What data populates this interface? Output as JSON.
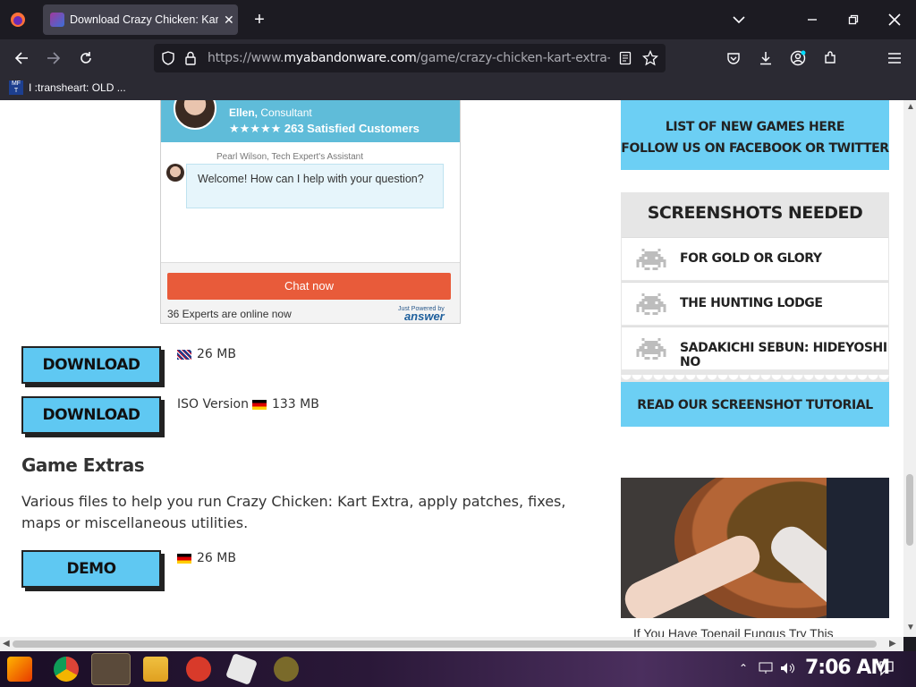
{
  "browser": {
    "tab_title": "Download Crazy Chicken: Kart Extra",
    "tab_close": "✕",
    "new_tab": "+",
    "url_prefix": "https://www.",
    "url_domain": "myabandonware.com",
    "url_path": "/game/crazy-chicken-kart-extra-do",
    "bookmark_label": "I :transheart: OLD ...",
    "bookmark_icon_text": "MF T"
  },
  "chat_widget": {
    "expert_name": "Ellen,",
    "expert_title": "Consultant",
    "rating": "★★★★★ 263 Satisfied Customers",
    "assistant_label": "Pearl Wilson, Tech Expert's Assistant",
    "message": "Welcome! How can I help with your question?",
    "chat_button": "Chat now",
    "online_text": "36 Experts are online now",
    "powered_small": "Just Powered by",
    "powered_brand": "answer"
  },
  "downloads": [
    {
      "label": "DOWNLOAD",
      "info": "26 MB",
      "flag": "uk",
      "prefix": ""
    },
    {
      "label": "DOWNLOAD",
      "info": "133 MB",
      "flag": "de",
      "prefix": "ISO Version"
    }
  ],
  "extras": {
    "title": "Game Extras",
    "description": "Various files to help you run Crazy Chicken: Kart Extra, apply patches, fixes, maps or miscellaneous utilities.",
    "demo_label": "DEMO",
    "demo_info": "26 MB"
  },
  "sidebar": {
    "new_games_line1": "LIST OF NEW GAMES HERE",
    "new_games_line2": "FOLLOW US ON FACEBOOK OR TWITTER",
    "screenshots_title": "SCREENSHOTS NEEDED",
    "screenshot_items": [
      "FOR GOLD OR GLORY",
      "THE HUNTING LODGE",
      "SADAKICHI SEBUN: HIDEYOSHI NO"
    ],
    "tutorial": "READ OUR SCREENSHOT TUTORIAL"
  },
  "ad": {
    "caption": "If You Have Toenail Fungus Try This"
  },
  "taskbar": {
    "clock": "7:06 AM"
  }
}
